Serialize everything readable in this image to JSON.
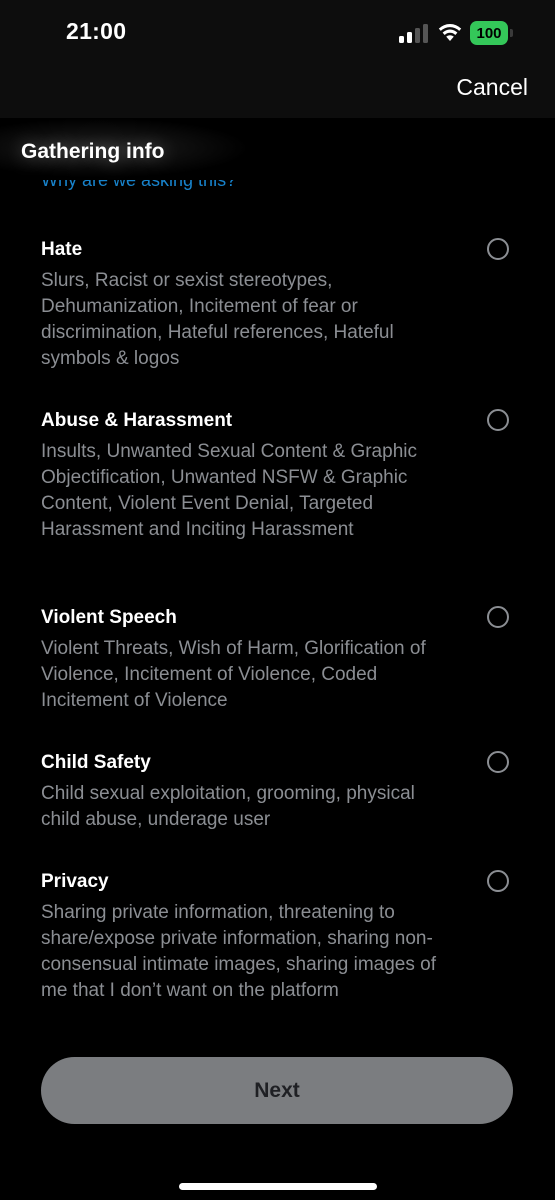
{
  "status_bar": {
    "time": "21:00",
    "battery_level": "100",
    "battery_color": "#34c759"
  },
  "nav": {
    "cancel_label": "Cancel"
  },
  "header": {
    "title": "Gathering info",
    "why_link": "Why are we asking this?"
  },
  "options": [
    {
      "title": "Hate",
      "description": "Slurs, Racist or sexist stereotypes, Dehumanization, Incitement of fear or discrimination, Hateful references, Hateful symbols & logos"
    },
    {
      "title": "Abuse & Harassment",
      "description": "Insults, Unwanted Sexual Content & Graphic Objectification, Unwanted NSFW & Graphic Content, Violent Event Denial, Targeted Harassment and Inciting Harassment"
    },
    {
      "title": "Violent Speech",
      "description": "Violent Threats, Wish of Harm, Glorification of Violence, Incitement of Violence, Coded Incitement of Violence"
    },
    {
      "title": "Child Safety",
      "description": "Child sexual exploitation, grooming, physical child abuse, underage user"
    },
    {
      "title": "Privacy",
      "description": "Sharing private information, threatening to share/expose private information, sharing non-consensual intimate images, sharing images of me that I don’t want on the platform"
    }
  ],
  "footer": {
    "next_label": "Next"
  },
  "colors": {
    "link": "#1d9bf0",
    "secondary_text": "#8b8e93",
    "button_disabled": "#7b7d80"
  }
}
